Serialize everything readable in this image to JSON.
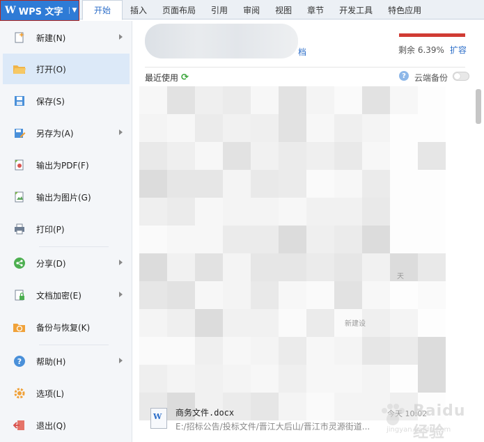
{
  "app": {
    "logo": "W",
    "name": "WPS 文字",
    "caret": "▼"
  },
  "ribbon": {
    "tabs": [
      "开始",
      "插入",
      "页面布局",
      "引用",
      "审阅",
      "视图",
      "章节",
      "开发工具",
      "特色应用"
    ],
    "active": "开始"
  },
  "menu": {
    "items": [
      {
        "label": "新建(N)",
        "icon": "new-doc-icon",
        "submenu": true
      },
      {
        "label": "打开(O)",
        "icon": "folder-open-icon",
        "submenu": false,
        "active": true
      },
      {
        "label": "保存(S)",
        "icon": "save-icon",
        "submenu": false
      },
      {
        "label": "另存为(A)",
        "icon": "save-as-icon",
        "submenu": true
      },
      {
        "label": "输出为PDF(F)",
        "icon": "pdf-icon",
        "submenu": false
      },
      {
        "label": "输出为图片(G)",
        "icon": "image-export-icon",
        "submenu": false
      },
      {
        "label": "打印(P)",
        "icon": "printer-icon",
        "submenu": false
      },
      {
        "label": "分享(D)",
        "icon": "share-icon",
        "submenu": true
      },
      {
        "label": "文档加密(E)",
        "icon": "lock-doc-icon",
        "submenu": true
      },
      {
        "label": "备份与恢复(K)",
        "icon": "backup-icon",
        "submenu": false
      },
      {
        "label": "帮助(H)",
        "icon": "help-icon",
        "submenu": true
      },
      {
        "label": "选项(L)",
        "icon": "gear-icon",
        "submenu": false
      },
      {
        "label": "退出(Q)",
        "icon": "exit-icon",
        "submenu": false
      }
    ]
  },
  "account": {
    "name_tail": "档",
    "storage_remaining_label": "剩余 6.39%",
    "storage_remaining_pct": 6.39,
    "expand_label": "扩容"
  },
  "recent": {
    "title": "最近使用",
    "cloud_backup_label": "云端备份",
    "cloud_backup_on": false,
    "files": [
      {
        "name": "商务文件.docx",
        "path": "E:/招标公告/投标文件/晋江大后山/晋江市灵源街道...",
        "meta": "今天 10:02"
      }
    ],
    "blurred_fragments": [
      "天",
      "...",
      "/...",
      "新建设"
    ]
  },
  "watermark": {
    "text": "Baidu 经验",
    "sub": "jingyan.baidu.com"
  },
  "colors": {
    "accent": "#2e7bd6",
    "active_menu_bg": "#dce9f8",
    "storage_bar": "#d03b34",
    "link": "#2e6fc9"
  }
}
